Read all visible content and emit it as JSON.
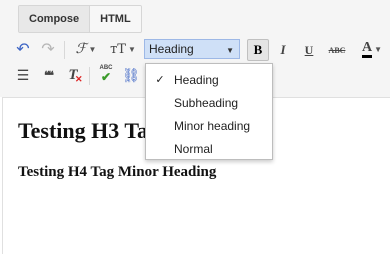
{
  "modes": {
    "compose": "Compose",
    "html": "HTML"
  },
  "toolbar": {
    "undo_icon": "↶",
    "redo_icon": "↷",
    "font_icon": "ℱ",
    "font_size_icon": "тT",
    "heading_value": "Heading",
    "bold": "B",
    "italic": "I",
    "underline": "U",
    "strike": "ABC",
    "text_color": "A",
    "bullets_icon": "☰",
    "quote_icon": "❝❝",
    "clear_format": "T",
    "spell_check": "ABC"
  },
  "heading_menu": {
    "items": [
      {
        "label": "Heading",
        "checked": true
      },
      {
        "label": "Subheading",
        "checked": false
      },
      {
        "label": "Minor heading",
        "checked": false
      },
      {
        "label": "Normal",
        "checked": false
      }
    ],
    "check_mark": "✓"
  },
  "editor": {
    "h3_text": "Testing H3 Tag Heading",
    "h4_text": "Testing H4 Tag Minor Heading"
  },
  "colors": {
    "select_bg": "#cfe0f7",
    "select_border": "#9db8e6",
    "text_color_underline": "#000000"
  }
}
